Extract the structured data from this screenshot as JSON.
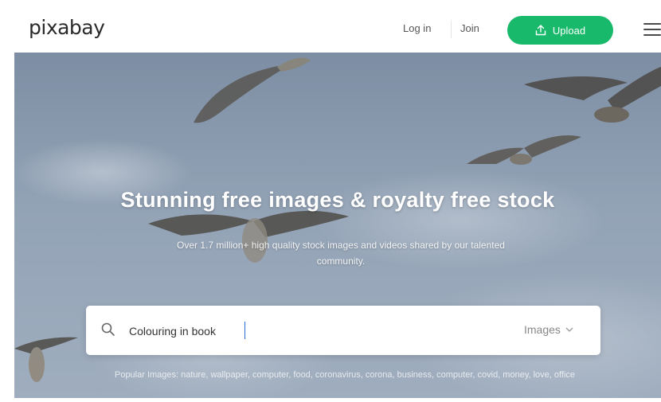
{
  "header": {
    "logo": "pixabay",
    "login_label": "Log in",
    "join_label": "Join",
    "upload_label": "Upload",
    "upload_color": "#19b96b"
  },
  "hero": {
    "title": "Stunning free images & royalty free stock",
    "subtitle": "Over 1.7 million+ high quality stock images and videos shared by our talented community."
  },
  "search": {
    "value": "Colouring in book",
    "type_label": "Images"
  },
  "popular": {
    "text": "Popular Images: nature, wallpaper, computer, food, coronavirus, corona, business, computer, covid, money, love, office"
  },
  "icons": {
    "upload": "upload-icon",
    "menu": "hamburger-menu-icon",
    "search": "search-icon",
    "dropdown": "chevron-down-icon"
  }
}
